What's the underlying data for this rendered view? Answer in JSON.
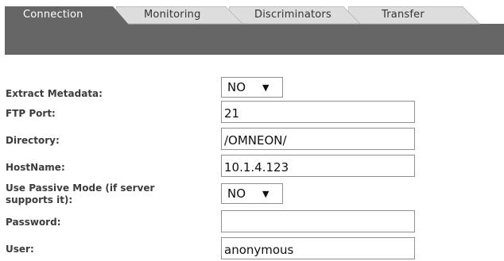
{
  "tabs": [
    {
      "label": "Connection",
      "active": true
    },
    {
      "label": "Monitoring",
      "active": false
    },
    {
      "label": "Discriminators",
      "active": false
    },
    {
      "label": "Transfer",
      "active": false
    }
  ],
  "colors": {
    "active_tab": "#666666",
    "inactive_tab": "#dddddd",
    "label_text": "#3c3c3c",
    "input_border": "#8f8f8f"
  },
  "form": {
    "extract_metadata": {
      "label": "Extract Metadata:",
      "value": "NO",
      "arrow": "▼"
    },
    "ftp_port": {
      "label": "FTP Port:",
      "value": "21"
    },
    "directory": {
      "label": "Directory:",
      "value": "/OMNEON/"
    },
    "hostname": {
      "label": "HostName:",
      "value": "10.1.4.123"
    },
    "passive_mode": {
      "label_line1": "Use Passive Mode (if server",
      "label_line2": "supports it):",
      "value": "NO",
      "arrow": "▼"
    },
    "password": {
      "label": "Password:",
      "value": ""
    },
    "user": {
      "label": "User:",
      "value": "anonymous"
    }
  }
}
